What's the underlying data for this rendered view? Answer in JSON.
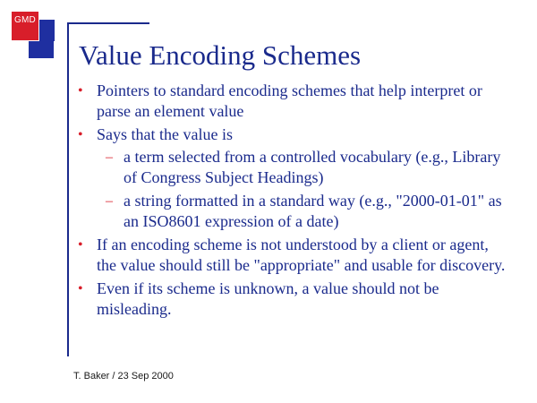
{
  "logo": {
    "text": "GMD"
  },
  "title": "Value Encoding Schemes",
  "bullets": [
    {
      "text": "Pointers to standard encoding schemes that help interpret or parse an element value"
    },
    {
      "text": "Says that the value is",
      "sub": [
        "a term selected from a controlled vocabulary (e.g., Library of Congress Subject Headings)",
        "a string formatted in a standard way (e.g., \"2000-01-01\" as an ISO8601 expression of a date)"
      ]
    },
    {
      "text": "If an encoding scheme is not understood by a client or agent, the value should still be \"appropriate\" and usable for discovery."
    },
    {
      "text": "Even if its scheme is unknown, a value should not be misleading."
    }
  ],
  "footer": "T. Baker / 23 Sep 2000",
  "colors": {
    "text": "#1a2a8c",
    "bullet": "#d81e2a",
    "logo_red": "#d81e2a",
    "logo_blue": "#1f2fa0"
  },
  "icons": {
    "bullet": "•",
    "sub_bullet": "–"
  }
}
